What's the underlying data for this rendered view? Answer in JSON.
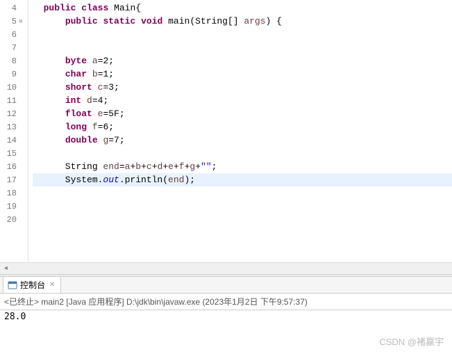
{
  "editor": {
    "lines": [
      {
        "no": 4,
        "ann": "",
        "tokens": [
          [
            "  ",
            ""
          ],
          [
            "public",
            "kw"
          ],
          [
            " ",
            ""
          ],
          [
            "class",
            "kw"
          ],
          [
            " ",
            ""
          ],
          [
            "Main",
            "cls"
          ],
          [
            "{",
            ""
          ]
        ]
      },
      {
        "no": 5,
        "ann": "⊖",
        "tokens": [
          [
            "      ",
            ""
          ],
          [
            "public",
            "kw"
          ],
          [
            " ",
            ""
          ],
          [
            "static",
            "kw"
          ],
          [
            " ",
            ""
          ],
          [
            "void",
            "kw"
          ],
          [
            " ",
            ""
          ],
          [
            "main",
            "mtd"
          ],
          [
            "(String[] ",
            ""
          ],
          [
            "args",
            "var"
          ],
          [
            ") {",
            ""
          ]
        ]
      },
      {
        "no": 6,
        "ann": "",
        "tokens": [
          [
            "",
            ""
          ]
        ]
      },
      {
        "no": 7,
        "ann": "",
        "tokens": [
          [
            "",
            ""
          ]
        ]
      },
      {
        "no": 8,
        "ann": "",
        "tokens": [
          [
            "      ",
            ""
          ],
          [
            "byte",
            "kw"
          ],
          [
            " ",
            ""
          ],
          [
            "a",
            "var"
          ],
          [
            "=2;",
            ""
          ]
        ]
      },
      {
        "no": 9,
        "ann": "",
        "tokens": [
          [
            "      ",
            ""
          ],
          [
            "char",
            "kw"
          ],
          [
            " ",
            ""
          ],
          [
            "b",
            "var"
          ],
          [
            "=1;",
            ""
          ]
        ]
      },
      {
        "no": 10,
        "ann": "",
        "tokens": [
          [
            "      ",
            ""
          ],
          [
            "short",
            "kw"
          ],
          [
            " ",
            ""
          ],
          [
            "c",
            "var"
          ],
          [
            "=3;",
            ""
          ]
        ]
      },
      {
        "no": 11,
        "ann": "",
        "tokens": [
          [
            "      ",
            ""
          ],
          [
            "int",
            "kw"
          ],
          [
            " ",
            ""
          ],
          [
            "d",
            "var"
          ],
          [
            "=4;",
            ""
          ]
        ]
      },
      {
        "no": 12,
        "ann": "",
        "tokens": [
          [
            "      ",
            ""
          ],
          [
            "float",
            "kw"
          ],
          [
            " ",
            ""
          ],
          [
            "e",
            "var"
          ],
          [
            "=5F;",
            ""
          ]
        ]
      },
      {
        "no": 13,
        "ann": "",
        "tokens": [
          [
            "      ",
            ""
          ],
          [
            "long",
            "kw"
          ],
          [
            " ",
            ""
          ],
          [
            "f",
            "var"
          ],
          [
            "=6;",
            ""
          ]
        ]
      },
      {
        "no": 14,
        "ann": "",
        "tokens": [
          [
            "      ",
            ""
          ],
          [
            "double",
            "kw"
          ],
          [
            " ",
            ""
          ],
          [
            "g",
            "var"
          ],
          [
            "=7;",
            ""
          ]
        ]
      },
      {
        "no": 15,
        "ann": "",
        "tokens": [
          [
            "",
            ""
          ]
        ]
      },
      {
        "no": 16,
        "ann": "",
        "tokens": [
          [
            "      String ",
            ""
          ],
          [
            "end",
            "var"
          ],
          [
            "=",
            ""
          ],
          [
            "a",
            "var"
          ],
          [
            "+",
            ""
          ],
          [
            "b",
            "var"
          ],
          [
            "+",
            ""
          ],
          [
            "c",
            "var"
          ],
          [
            "+",
            ""
          ],
          [
            "d",
            "var"
          ],
          [
            "+",
            ""
          ],
          [
            "e",
            "var"
          ],
          [
            "+",
            ""
          ],
          [
            "f",
            "var"
          ],
          [
            "+",
            ""
          ],
          [
            "g",
            "var"
          ],
          [
            "+",
            ""
          ],
          [
            "\"\"",
            "str"
          ],
          [
            ";",
            ""
          ]
        ]
      },
      {
        "no": 17,
        "ann": "",
        "hl": true,
        "tokens": [
          [
            "      System.",
            ""
          ],
          [
            "out",
            "fld"
          ],
          [
            ".println(",
            ""
          ],
          [
            "end",
            "var"
          ],
          [
            ");",
            ""
          ]
        ]
      },
      {
        "no": 18,
        "ann": "",
        "tokens": [
          [
            "",
            ""
          ]
        ]
      },
      {
        "no": 19,
        "ann": "",
        "tokens": [
          [
            "",
            ""
          ]
        ]
      },
      {
        "no": 20,
        "ann": "",
        "tokens": [
          [
            "",
            ""
          ]
        ]
      }
    ]
  },
  "console": {
    "tab_label": "控制台",
    "close_glyph": "✕",
    "status": "<已终止> main2 [Java 应用程序] D:\\jdk\\bin\\javaw.exe  (2023年1月2日 下午9:57:37)",
    "output": "28.0"
  },
  "watermark": "CSDN @褚赢宇"
}
